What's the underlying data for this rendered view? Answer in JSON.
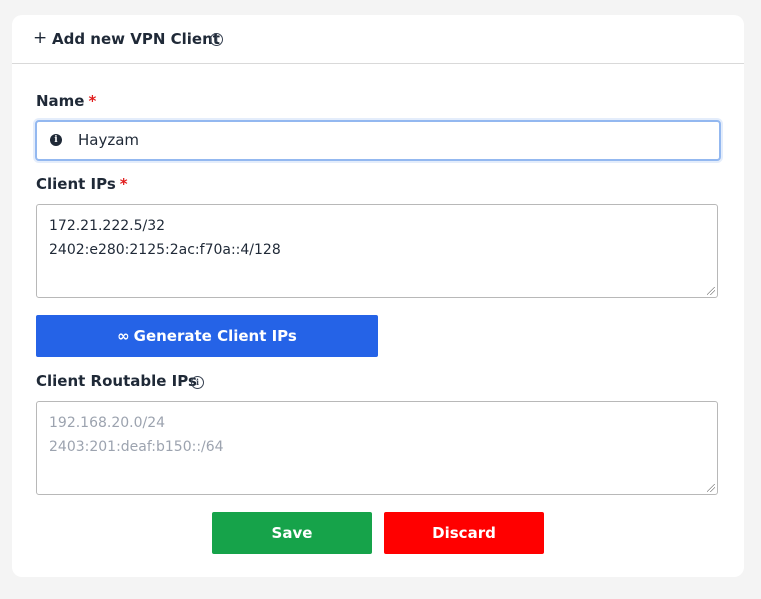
{
  "header": {
    "plus_symbol": "+",
    "title": "Add new VPN Client",
    "info_icon": "info-circle-icon"
  },
  "form": {
    "name": {
      "label": "Name",
      "required_mark": "*",
      "value": "Hayzam",
      "icon": "info-filled-icon"
    },
    "client_ips": {
      "label": "Client IPs",
      "required_mark": "*",
      "lines": [
        "172.21.222.5/32",
        "2402:e280:2125:2ac:f70a::4/128"
      ]
    },
    "generate_button": {
      "icon": "infinity-icon",
      "icon_glyph": "∞",
      "label": "Generate Client IPs"
    },
    "routable_ips": {
      "label": "Client Routable IPs",
      "info_icon": "info-circle-icon",
      "placeholder_lines": [
        "192.168.20.0/24",
        "2403:201:deaf:b150::/64"
      ]
    }
  },
  "actions": {
    "save_label": "Save",
    "discard_label": "Discard"
  },
  "colors": {
    "primary": "#2563e7",
    "success": "#16a34a",
    "danger": "#ff0000",
    "required": "#e11d1d",
    "focus_border": "#93b8f0"
  }
}
